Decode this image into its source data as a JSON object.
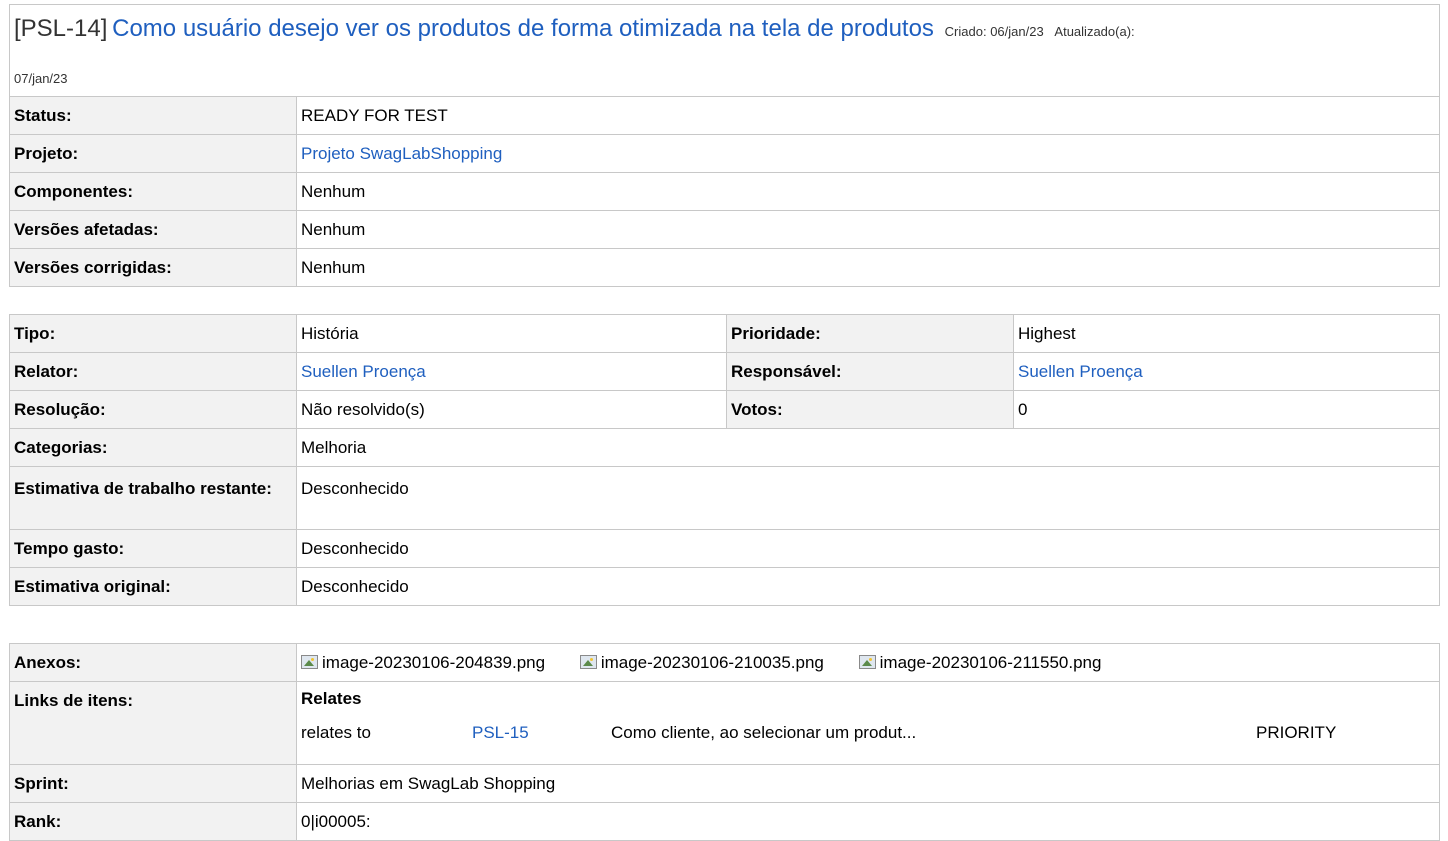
{
  "header": {
    "key": "[PSL-14]",
    "summary": "Como usuário desejo ver os produtos de forma otimizada na tela de produtos",
    "created": "Criado: 06/jan/23",
    "updated_label": "Atualizado(a):",
    "updated_date": "07/jan/23"
  },
  "details1": [
    {
      "label": "Status:",
      "value": "READY FOR TEST"
    },
    {
      "label": "Projeto:",
      "value": "Projeto SwagLabShopping"
    },
    {
      "label": "Componentes:",
      "value": "Nenhum"
    },
    {
      "label": "Versões afetadas:",
      "value": "Nenhum"
    },
    {
      "label": "Versões corrigidas:",
      "value": "Nenhum"
    }
  ],
  "details2": {
    "tipo_label": "Tipo:",
    "tipo": "História",
    "prioridade_label": "Prioridade:",
    "prioridade": "Highest",
    "relator_label": "Relator:",
    "relator": "Suellen Proença",
    "responsavel_label": "Responsável:",
    "responsavel": "Suellen Proença",
    "resolucao_label": "Resolução:",
    "resolucao": "Não resolvido(s)",
    "votos_label": "Votos:",
    "votos": "0",
    "categorias_label": "Categorias:",
    "categorias": "Melhoria",
    "estimativa_restante_label": "Estimativa de trabalho restante:",
    "estimativa_restante": "Desconhecido",
    "tempo_gasto_label": "Tempo gasto:",
    "tempo_gasto": "Desconhecido",
    "estimativa_original_label": "Estimativa original:",
    "estimativa_original": "Desconhecido"
  },
  "details3": {
    "anexos_label": "Anexos:",
    "anexos": [
      "image-20230106-204839.png",
      "image-20230106-210035.png",
      "image-20230106-211550.png"
    ],
    "links_label": "Links de itens:",
    "links_group": "Relates",
    "link_relation": "relates to",
    "link_key": "PSL-15",
    "link_summary": "Como cliente, ao selecionar um produt...",
    "link_status": "PRIORITY",
    "sprint_label": "Sprint:",
    "sprint": "Melhorias em SwagLab Shopping",
    "rank_label": "Rank:",
    "rank": "0|i00005:"
  },
  "colors": {
    "link": "#1f5fbf",
    "border": "#c8c8c8",
    "label_bg": "#f2f2f2"
  }
}
